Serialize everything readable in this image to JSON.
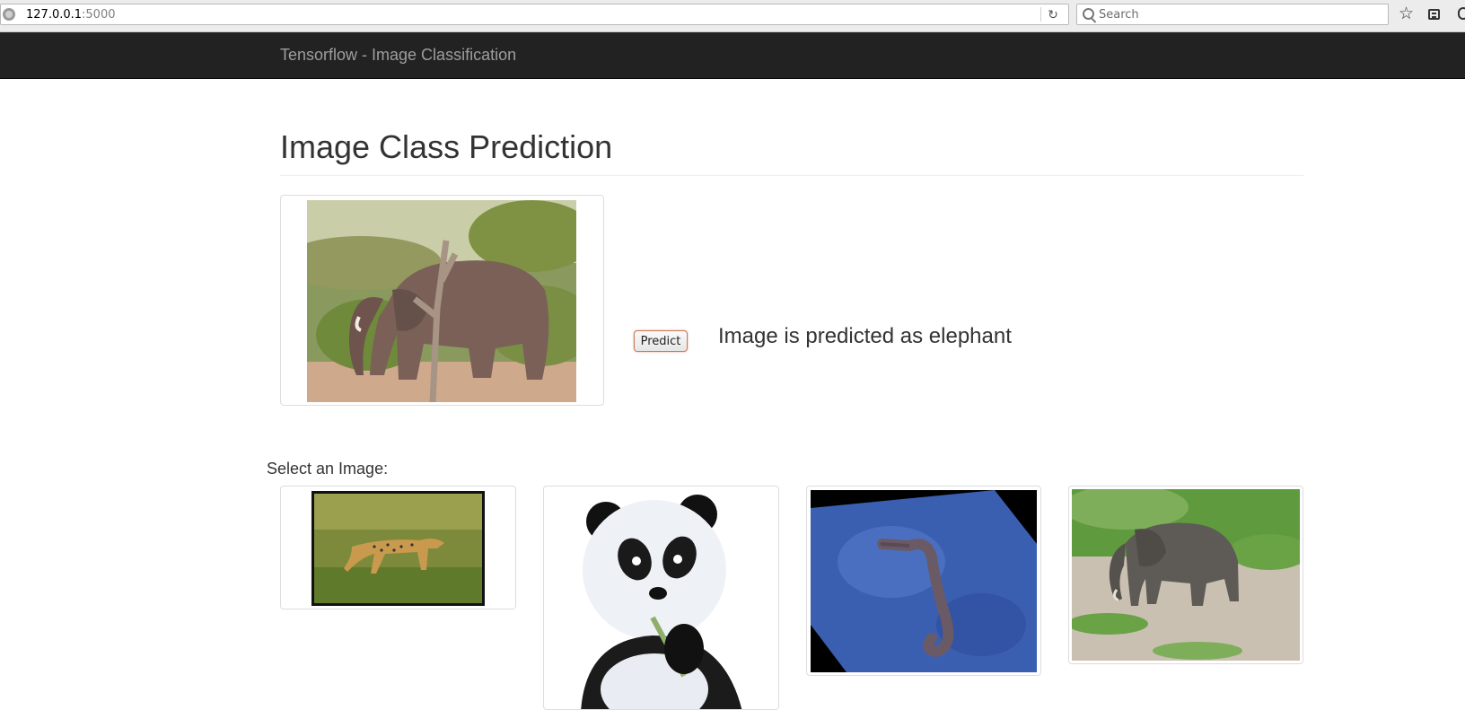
{
  "browser": {
    "url_host": "127.0.0.1",
    "url_port": ":5000",
    "search_placeholder": "Search",
    "icons": [
      "globe-icon",
      "reload-icon",
      "search-icon",
      "bookmark-star-icon",
      "library-icon",
      "overflow-icon"
    ]
  },
  "navbar": {
    "brand": "Tensorflow - Image Classification",
    "background": "#222222",
    "brand_color": "#9d9d9d"
  },
  "page": {
    "title": "Image Class Prediction"
  },
  "prediction": {
    "button_label": "Predict",
    "result_text": "Image is predicted as elephant"
  },
  "gallery": {
    "label": "Select an Image:",
    "images": [
      {
        "subject": "cheetah"
      },
      {
        "subject": "panda"
      },
      {
        "subject": "seahorse"
      },
      {
        "subject": "elephant"
      }
    ]
  }
}
